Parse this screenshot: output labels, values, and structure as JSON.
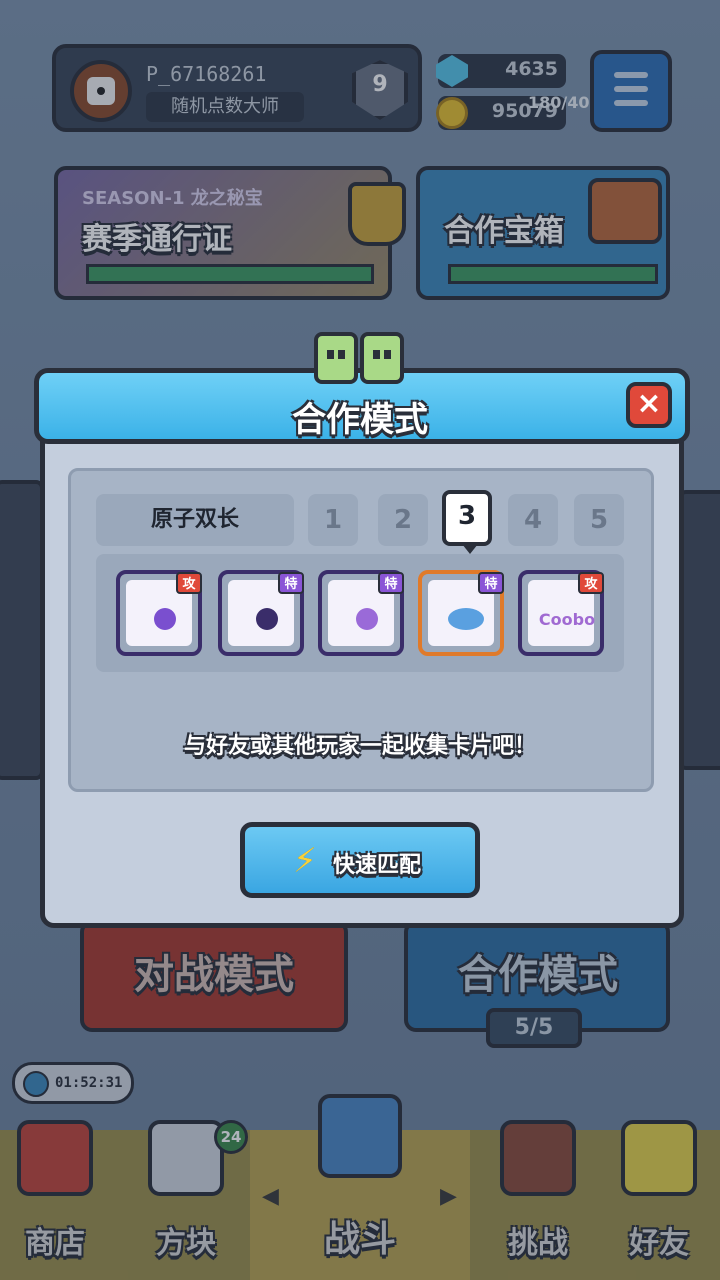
{
  "player": {
    "name": "P_67168261",
    "title": "随机点数大师",
    "rank": "9"
  },
  "currency": {
    "gems": "4635",
    "coins": "95079"
  },
  "season": {
    "label": "SEASON-1 龙之秘宝",
    "title": "赛季通行证"
  },
  "chest": {
    "title": "合作宝箱",
    "progress": "180/40"
  },
  "modal": {
    "title": "合作模式",
    "close": "×",
    "deck_name": "原子双长",
    "slots": [
      "1",
      "2",
      "3",
      "4",
      "5"
    ],
    "active_slot": "3",
    "cards": [
      {
        "tag": "攻",
        "tag_color": "#e0493a",
        "border": "#6a3fc0"
      },
      {
        "tag": "特",
        "tag_color": "#8a55d6",
        "border": "#6a3fc0"
      },
      {
        "tag": "特",
        "tag_color": "#8a55d6",
        "border": "#6a3fc0"
      },
      {
        "tag": "特",
        "tag_color": "#8a55d6",
        "border": "#e07a2a"
      },
      {
        "tag": "攻",
        "tag_color": "#e0493a",
        "border": "#6a3fc0"
      }
    ],
    "card5_logo": "Coobo",
    "hint": "与好友或其他玩家一起收集卡片吧！",
    "match_button": "快速匹配"
  },
  "modes": {
    "battle": "对战模式",
    "coop": "合作模式",
    "coop_count": "5/5"
  },
  "timer": "01:52:31",
  "nav": {
    "shop": "商店",
    "blocks": "方块",
    "blocks_badge": "24",
    "battle": "战斗",
    "challenge": "挑战",
    "friends": "好友"
  },
  "colors": {
    "accent_blue": "#3bb2e8",
    "close_red": "#e0493a",
    "outline": "#2a2f3a"
  }
}
